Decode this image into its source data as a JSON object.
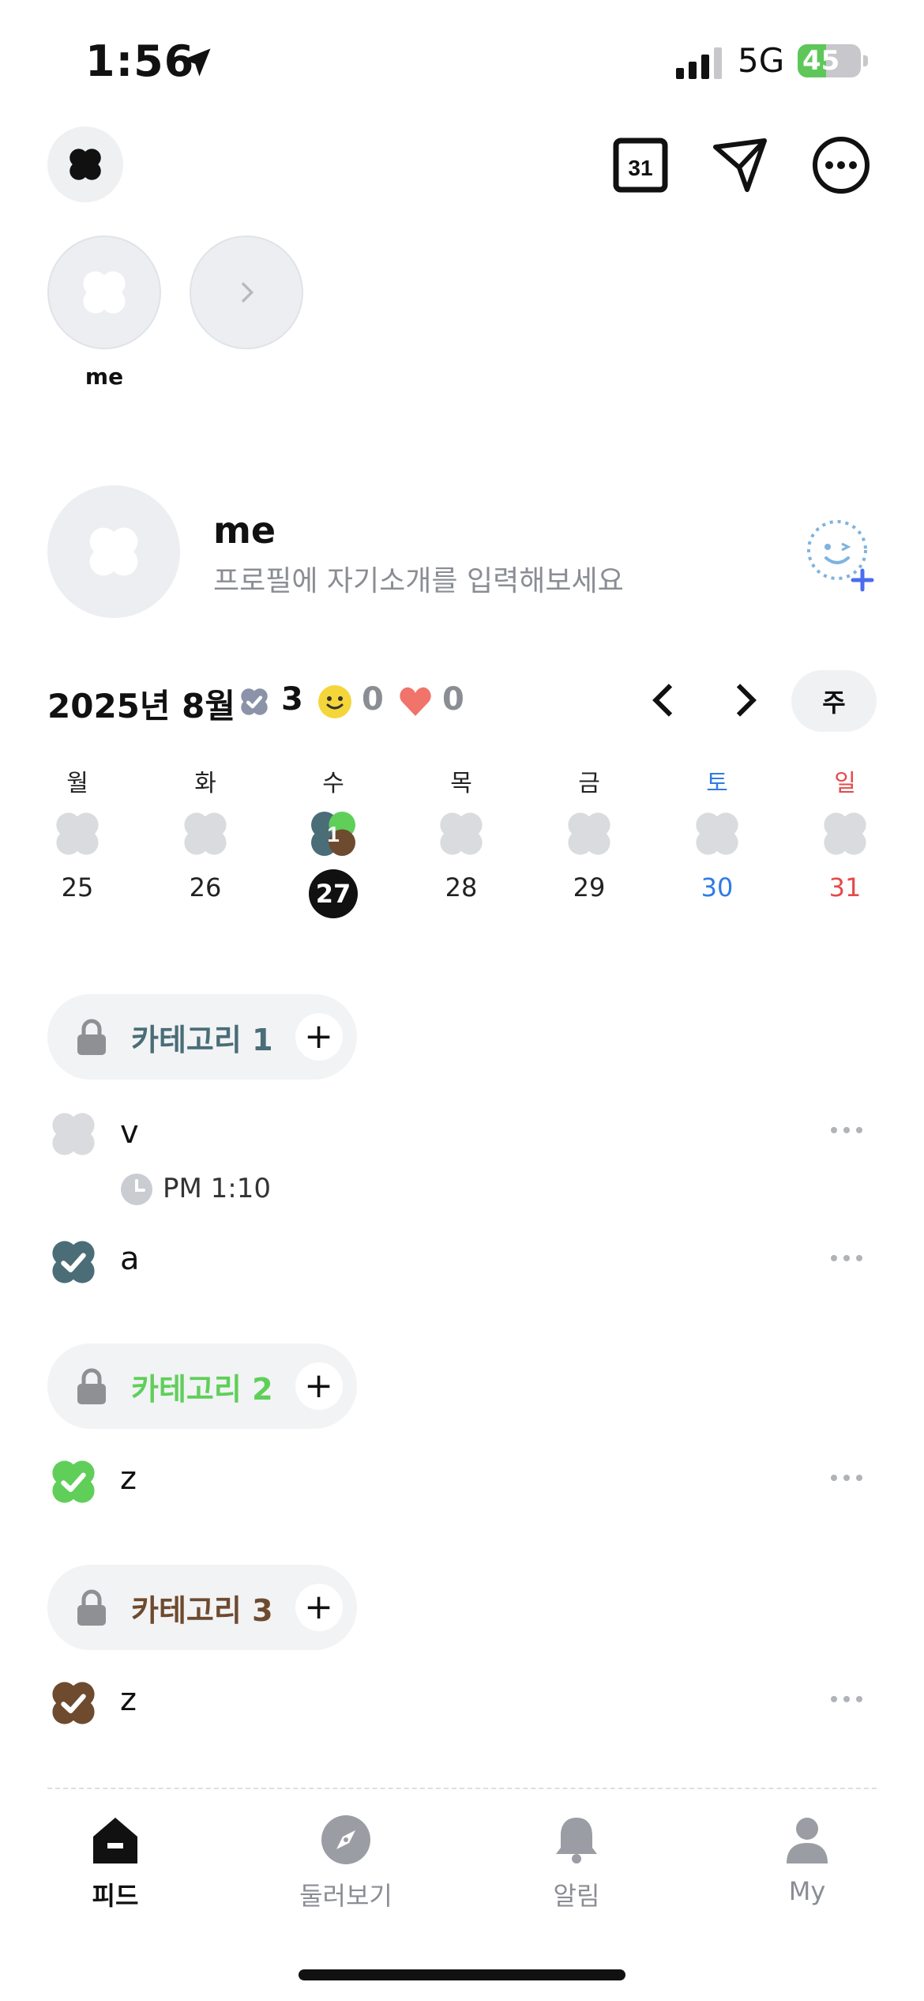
{
  "status_bar": {
    "time": "1:56",
    "network": "5G",
    "battery": "45",
    "battery_level": 0.45
  },
  "header": {
    "calendar_icon_text": "31"
  },
  "stories": [
    {
      "label": "me"
    }
  ],
  "profile": {
    "name": "me",
    "bio": "프로필에 자기소개를 입력해보세요"
  },
  "calendar": {
    "month_label": "2025년 8월",
    "stats": {
      "check_count": "3",
      "smile_count": "0",
      "heart_count": "0"
    },
    "view_toggle": "주",
    "days": [
      {
        "dow": "월",
        "date": "25"
      },
      {
        "dow": "화",
        "date": "26"
      },
      {
        "dow": "수",
        "date": "27",
        "badge": "1"
      },
      {
        "dow": "목",
        "date": "28"
      },
      {
        "dow": "금",
        "date": "29"
      },
      {
        "dow": "토",
        "date": "30"
      },
      {
        "dow": "일",
        "date": "31"
      }
    ]
  },
  "categories": [
    {
      "name": "카테고리 1",
      "color": "#4a6d78",
      "todos": [
        {
          "text": "v",
          "time": "PM 1:10",
          "done": false
        },
        {
          "text": "a",
          "done": true
        }
      ]
    },
    {
      "name": "카테고리 2",
      "color": "#5fcf5a",
      "todos": [
        {
          "text": "z",
          "done": true
        }
      ]
    },
    {
      "name": "카테고리 3",
      "color": "#6e4a2e",
      "todos": [
        {
          "text": "z",
          "done": true
        }
      ]
    }
  ],
  "tab_bar": {
    "feed": "피드",
    "explore": "둘러보기",
    "notifications": "알림",
    "my": "My"
  },
  "colors": {
    "saturday": "#2f7be5",
    "sunday": "#e54a4a",
    "petal_empty": "#d9dbde",
    "muted_text": "#8a8d93"
  }
}
